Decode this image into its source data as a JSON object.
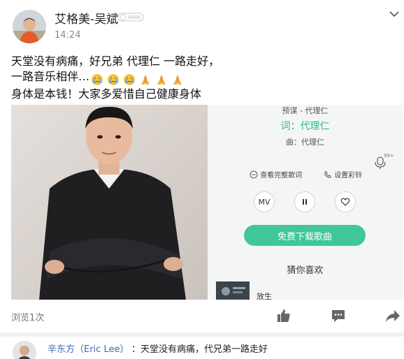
{
  "post": {
    "author": "艾格美-吴斌",
    "time": "14:24",
    "lines": [
      "天堂没有病痛，好兄弟 代理仁 一路走好，",
      "一路音乐相伴…",
      "身体是本钱！大家多爱惜自己健康身体"
    ],
    "emojis": [
      "crying-face-icon",
      "crying-face-icon",
      "crying-face-icon",
      "praying-hands-icon",
      "praying-hands-icon",
      "praying-hands-icon"
    ]
  },
  "music_card": {
    "top_line": "预谋 - 代理仁",
    "lyric_line": "词：代理仁",
    "composer_line": "曲：代理仁",
    "view_lyrics": "查看完整歌词",
    "set_ringtone": "设置彩铃",
    "mv_label": "MV",
    "download_label": "免费下载歌曲",
    "recommend_title": "猜你喜欢",
    "recommend_item": "放生",
    "mic_count": "99+"
  },
  "actions": {
    "views": "浏览1次"
  },
  "comment": {
    "author": "辛东方（Eric Lee）",
    "text": "：天堂没有病痛，代兄弟一路走好"
  },
  "colors": {
    "accent_green": "#3fc69a",
    "link_blue": "#3b6eb3"
  }
}
